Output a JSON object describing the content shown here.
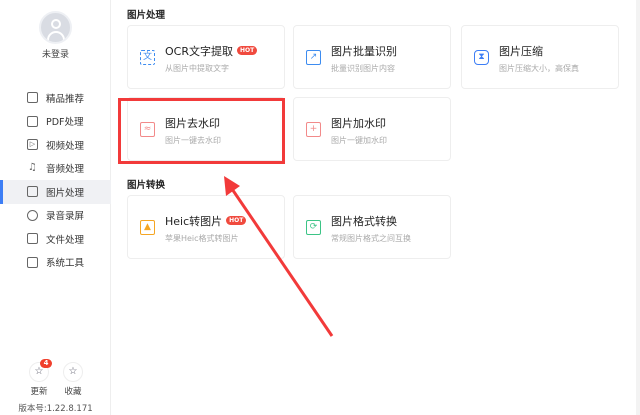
{
  "sidebar": {
    "login_label": "未登录",
    "items": [
      {
        "label": "精品推荐",
        "icon": "thumbs-up-icon"
      },
      {
        "label": "PDF处理",
        "icon": "pdf-icon"
      },
      {
        "label": "视频处理",
        "icon": "video-icon"
      },
      {
        "label": "音频处理",
        "icon": "music-icon"
      },
      {
        "label": "图片处理",
        "icon": "image-icon",
        "active": true
      },
      {
        "label": "录音录屏",
        "icon": "record-icon"
      },
      {
        "label": "文件处理",
        "icon": "folder-icon"
      },
      {
        "label": "系统工具",
        "icon": "system-tools-icon"
      }
    ],
    "update_label": "更新",
    "update_badge": "4",
    "favorite_label": "收藏",
    "version": "版本号:1.22.8.171"
  },
  "main": {
    "section1": "图片处理",
    "section2": "图片转换",
    "cards": [
      {
        "title": "OCR文字提取",
        "hot": "HOT",
        "desc": "从图片中提取文字",
        "color": "#3d8cf0"
      },
      {
        "title": "图片批量识别",
        "desc": "批量识别图片内容",
        "color": "#3d8cf0"
      },
      {
        "title": "图片压缩",
        "desc": "图片压缩大小，高保真",
        "color": "#3d7ef5"
      },
      {
        "title": "图片去水印",
        "desc": "图片一键去水印",
        "color": "#f28a8a"
      },
      {
        "title": "图片加水印",
        "desc": "图片一键加水印",
        "color": "#f28a8a"
      },
      {
        "title": "Heic转图片",
        "hot": "HOT",
        "desc": "苹果Heic格式转图片",
        "color": "#f5a623"
      },
      {
        "title": "图片格式转换",
        "desc": "常规图片格式之间互换",
        "color": "#3cc486"
      }
    ],
    "icon_glyphs": {
      "ocr": "文"
    }
  }
}
